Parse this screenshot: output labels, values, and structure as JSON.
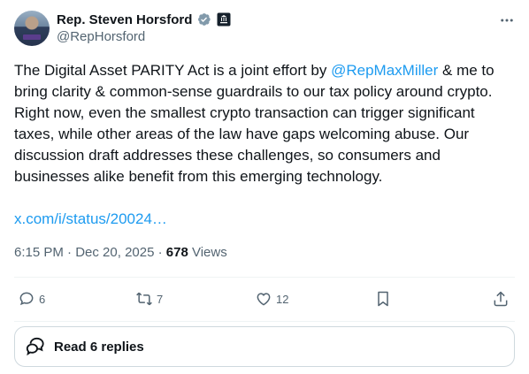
{
  "author": {
    "display_name": "Rep. Steven Horsford",
    "handle": "@RepHorsford"
  },
  "tweet": {
    "text_before": "The Digital Asset PARITY Act is a joint effort by ",
    "mention": "@RepMaxMiller",
    "text_after": " & me to bring clarity & common-sense guardrails to our tax policy around crypto. Right now, even the smallest crypto transaction can trigger significant taxes, while other areas of the law have gaps welcoming abuse. Our discussion draft addresses these challenges, so consumers and businesses alike benefit from this emerging technology.",
    "link": "x.com/i/status/20024…"
  },
  "meta": {
    "time": "6:15 PM",
    "separator": " · ",
    "date": "Dec 20, 2025",
    "views_count": "678",
    "views_label": " Views"
  },
  "actions": {
    "replies": "6",
    "reposts": "7",
    "likes": "12"
  },
  "read_replies": {
    "label": "Read 6 replies"
  },
  "colors": {
    "accent": "#1d9bf0",
    "text": "#0f1419",
    "secondary": "#536471",
    "border": "#cfd9de"
  },
  "icons": [
    "verified-badge-icon",
    "government-label-icon",
    "more-options-icon",
    "reply-icon",
    "repost-icon",
    "like-icon",
    "bookmark-icon",
    "share-icon",
    "chat-bubbles-icon"
  ]
}
